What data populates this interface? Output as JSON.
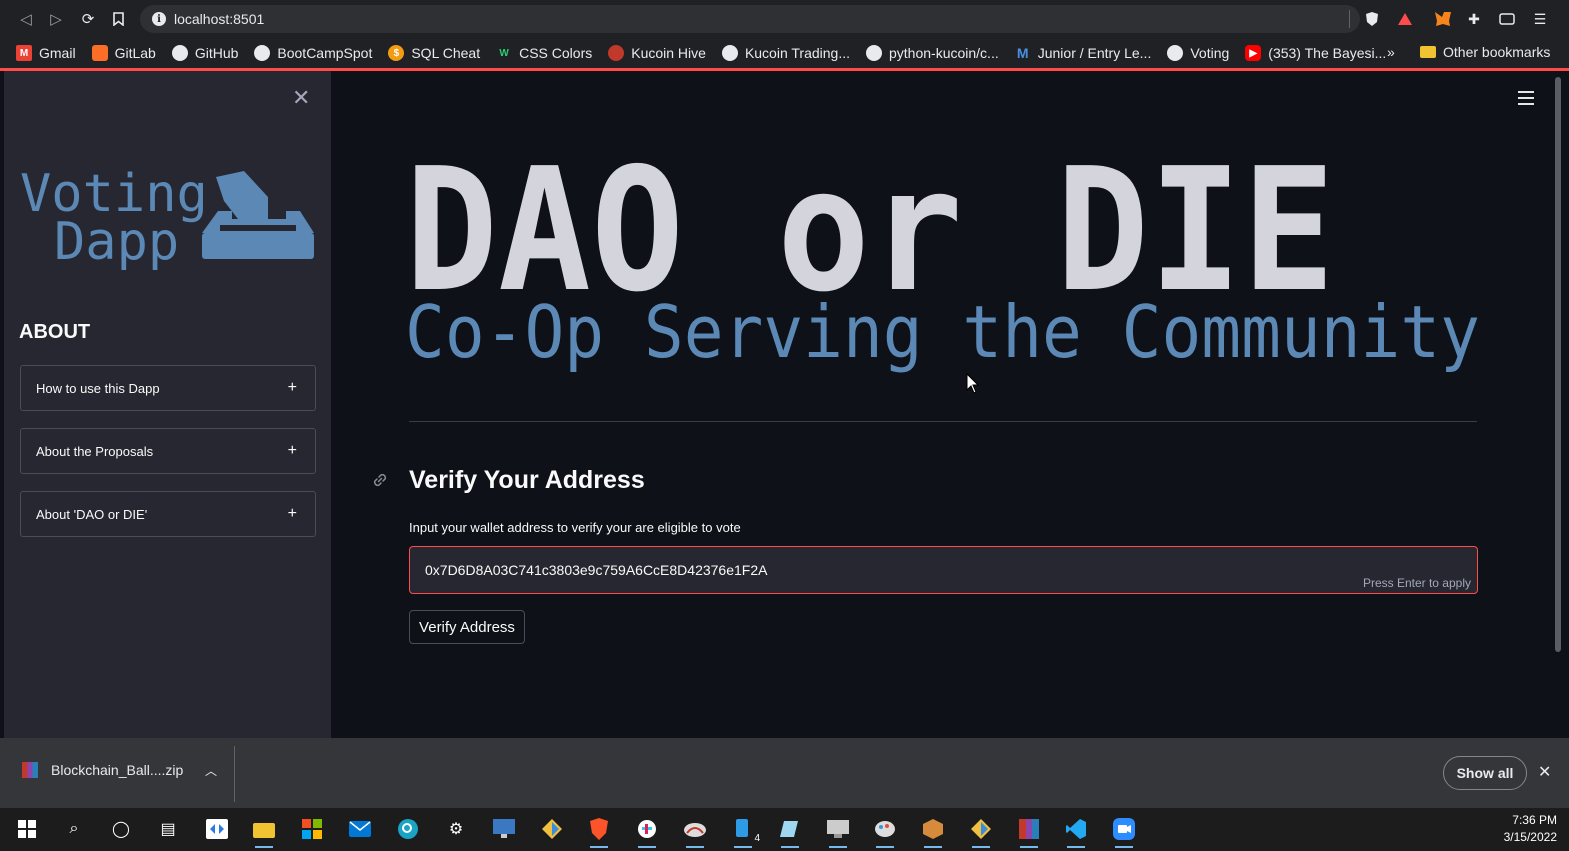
{
  "browser": {
    "url": "localhost:8501",
    "bookmarks": [
      "Gmail",
      "GitLab",
      "GitHub",
      "BootCampSpot",
      "SQL Cheat",
      "CSS Colors",
      "Kucoin Hive",
      "Kucoin Trading...",
      "python-kucoin/c...",
      "Junior / Entry Le...",
      "Voting",
      "(353) The Bayesi..."
    ],
    "more": "»",
    "other_bookmarks": "Other bookmarks"
  },
  "sidebar": {
    "close": "✕",
    "logo_line1": "Voting",
    "logo_line2": "Dapp",
    "about_title": "ABOUT",
    "expanders": [
      "How to use this Dapp",
      "About the Proposals",
      "About 'DAO or DIE'"
    ],
    "plus": "+"
  },
  "banner": {
    "title": "DAO or DIE",
    "subtitle": "Co-Op Serving the Community"
  },
  "main": {
    "heading": "Verify Your Address",
    "input_label": "Input your wallet address to verify your are eligible to vote",
    "input_value": "0x7D6D8A03C741c3803e9c759A6CcE8D42376e1F2A",
    "input_hint": "Press Enter to apply",
    "button": "Verify Address"
  },
  "download_bar": {
    "file": "Blockchain_Ball....zip",
    "show_all": "Show all",
    "close": "✕"
  },
  "taskbar": {
    "time": "7:36 PM",
    "date": "3/15/2022",
    "badge": "4"
  },
  "colors": {
    "accent": "#ff4b4b",
    "banner_title": "#d4d4dc",
    "banner_subtitle": "#5b88b5",
    "sidebar_bg": "#262730",
    "main_bg": "#0e1117"
  }
}
